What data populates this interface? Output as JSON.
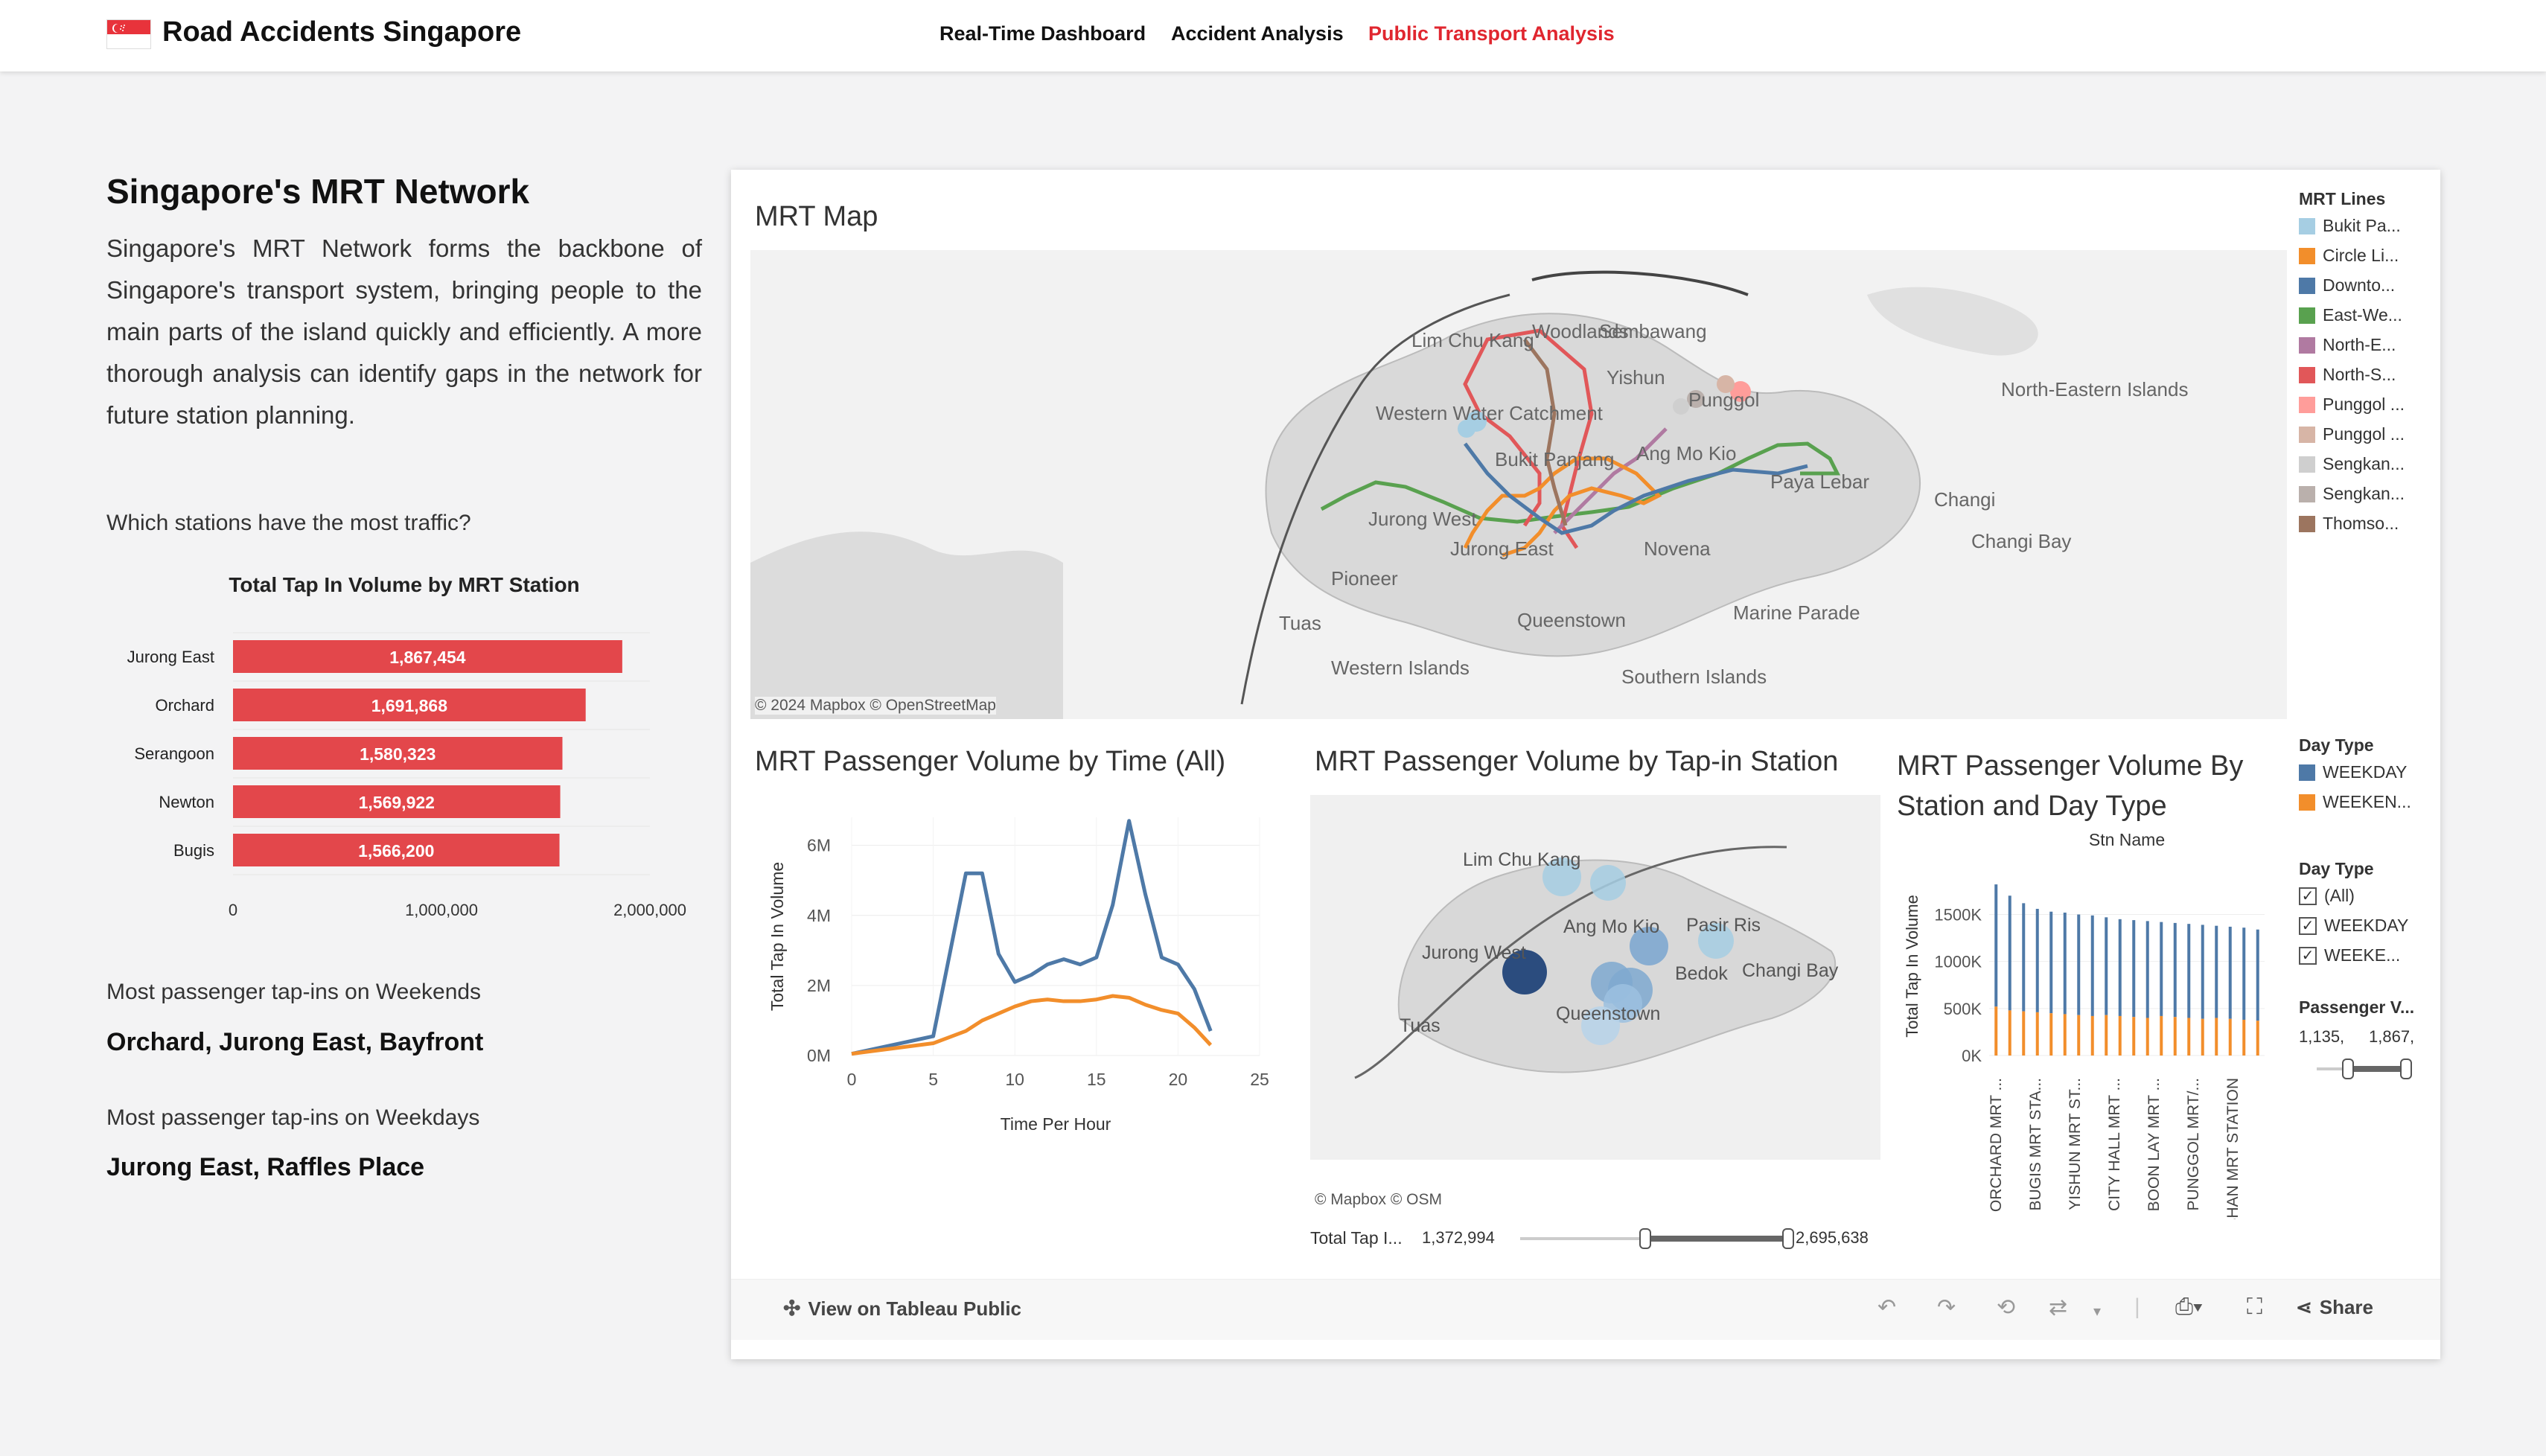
{
  "nav": {
    "brand": "Road Accidents Singapore",
    "links": [
      "Real-Time Dashboard",
      "Accident Analysis",
      "Public Transport Analysis"
    ],
    "active_index": 2
  },
  "left": {
    "heading": "Singapore's MRT Network",
    "intro": "Singapore's MRT Network forms the backbone of Singapore's transport system, bringing people to the main parts of the island quickly and efficiently. A more thorough analysis can identify gaps in the network for future station planning.",
    "question_traffic": "Which stations have the most traffic?",
    "weekend_label": "Most passenger tap-ins on Weekends",
    "weekend_value": "Orchard, Jurong East, Bayfront",
    "weekday_label": "Most passenger tap-ins on Weekdays",
    "weekday_value": "Jurong East, Raffles Place"
  },
  "chart_data": [
    {
      "type": "bar",
      "title": "Total Tap In Volume by MRT Station",
      "orientation": "horizontal",
      "categories": [
        "Jurong East",
        "Orchard",
        "Serangoon",
        "Newton",
        "Bugis"
      ],
      "values": [
        1867454,
        1691868,
        1580323,
        1569922,
        1566200
      ],
      "data_labels": [
        "1,867,454",
        "1,691,868",
        "1,580,323",
        "1,569,922",
        "1,566,200"
      ],
      "xlim": [
        0,
        2000000
      ],
      "xticks": [
        "0",
        "1,000,000",
        "2,000,000"
      ],
      "color": "#e3474b"
    },
    {
      "type": "line",
      "title": "MRT Passenger Volume by Time (All)",
      "xlabel": "Time Per Hour",
      "ylabel": "Total Tap In Volume",
      "xlim": [
        0,
        25
      ],
      "ylim": [
        0,
        6800000
      ],
      "xticks": [
        "0",
        "5",
        "10",
        "15",
        "20",
        "25"
      ],
      "yticks": [
        "0M",
        "2M",
        "4M",
        "6M"
      ],
      "x": [
        0,
        5,
        7,
        8,
        9,
        10,
        11,
        12,
        13,
        14,
        15,
        16,
        17,
        18,
        19,
        20,
        21,
        22,
        23
      ],
      "series": [
        {
          "name": "WEEKDAY",
          "color": "#4e79a7",
          "values": [
            0.05,
            0.55,
            5.2,
            5.2,
            2.9,
            2.1,
            2.3,
            2.6,
            2.75,
            2.6,
            2.8,
            4.3,
            6.7,
            4.6,
            2.8,
            2.6,
            1.9,
            0.7,
            null
          ]
        },
        {
          "name": "WEEKEND",
          "color": "#f28e2b",
          "values": [
            0.05,
            0.35,
            0.7,
            1.0,
            1.2,
            1.4,
            1.55,
            1.6,
            1.55,
            1.55,
            1.6,
            1.7,
            1.65,
            1.45,
            1.3,
            1.2,
            0.8,
            0.3,
            null
          ]
        }
      ]
    },
    {
      "type": "bar",
      "title": "MRT Passenger Volume By Station and Day Type",
      "xlabel": "Stn Name",
      "ylabel": "Total Tap In Volume",
      "ylim": [
        0,
        1900000
      ],
      "yticks": [
        "0K",
        "500K",
        "1000K",
        "1500K"
      ],
      "categories": [
        "ORCHARD MRT ...",
        "BUGIS MRT STA...",
        "YISHUN MRT ST...",
        "CITY HALL MRT ...",
        "BOON LAY MRT ...",
        "PUNGGOL MRT/...",
        "BISHAN MRT STATION"
      ],
      "series": [
        {
          "name": "WEEKDAY",
          "color": "#4e79a7",
          "values": [
            1820000,
            1700000,
            1620000,
            1560000,
            1530000,
            1520000,
            1500000,
            1490000,
            1470000,
            1450000,
            1440000,
            1430000,
            1420000,
            1410000,
            1400000,
            1390000,
            1380000,
            1370000,
            1360000,
            1340000
          ]
        },
        {
          "name": "WEEKEND",
          "color": "#f28e2b",
          "values": [
            520000,
            480000,
            470000,
            460000,
            450000,
            440000,
            430000,
            420000,
            430000,
            420000,
            410000,
            400000,
            420000,
            410000,
            400000,
            390000,
            400000,
            390000,
            380000,
            370000
          ]
        }
      ]
    }
  ],
  "dashboard": {
    "map_title": "MRT Map",
    "map_attrib": "© 2024 Mapbox  © OpenStreetMap",
    "map_labels": [
      "Lim Chu Kang",
      "Woodlands",
      "Sembawang",
      "Yishun",
      "Punggol",
      "North-Eastern Islands",
      "Western Water Catchment",
      "Bukit Panjang",
      "Ang Mo Kio",
      "Paya Lebar",
      "Changi",
      "Changi Bay",
      "Jurong West",
      "Jurong East",
      "Pioneer",
      "Tuas",
      "Queenstown",
      "Marine Parade",
      "Western Islands",
      "Southern Islands",
      "Novena"
    ],
    "bubble_title": "MRT Passenger Volume by Tap-in Station",
    "bubble_attrib": "© Mapbox  © OSM",
    "bubble_labels": [
      "Lim Chu Kang",
      "Ang Mo Kio",
      "Pasir Ris",
      "Jurong West",
      "Bedok",
      "Changi Bay",
      "Tuas",
      "Queenstown"
    ],
    "slider_label": "Total Tap I...",
    "slider_min": "1,372,994",
    "slider_max": "2,695,638",
    "legend_lines_title": "MRT Lines",
    "legend_lines": [
      {
        "label": "Bukit Pa...",
        "color": "#a6cee3"
      },
      {
        "label": "Circle Li...",
        "color": "#f28e2b"
      },
      {
        "label": "Downto...",
        "color": "#4e79a7"
      },
      {
        "label": "East-We...",
        "color": "#59a14f"
      },
      {
        "label": "North-E...",
        "color": "#b07aa1"
      },
      {
        "label": "North-S...",
        "color": "#e15759"
      },
      {
        "label": "Punggol ...",
        "color": "#ff9d9a"
      },
      {
        "label": "Punggol ...",
        "color": "#d7b5a6"
      },
      {
        "label": "Sengkan...",
        "color": "#cfcfcf"
      },
      {
        "label": "Sengkan...",
        "color": "#bab0ac"
      },
      {
        "label": "Thomso...",
        "color": "#9c755f"
      }
    ],
    "legend_day_title": "Day Type",
    "legend_day": [
      {
        "label": "WEEKDAY",
        "color": "#4e79a7"
      },
      {
        "label": "WEEKEN...",
        "color": "#f28e2b"
      }
    ],
    "filter_day_title": "Day Type",
    "filter_day": [
      "(All)",
      "WEEKDAY",
      "WEEKE..."
    ],
    "pv_title": "Passenger V...",
    "pv_min": "1,135,",
    "pv_max": "1,867,",
    "footer_view": "View on Tableau Public",
    "footer_share": "Share"
  }
}
